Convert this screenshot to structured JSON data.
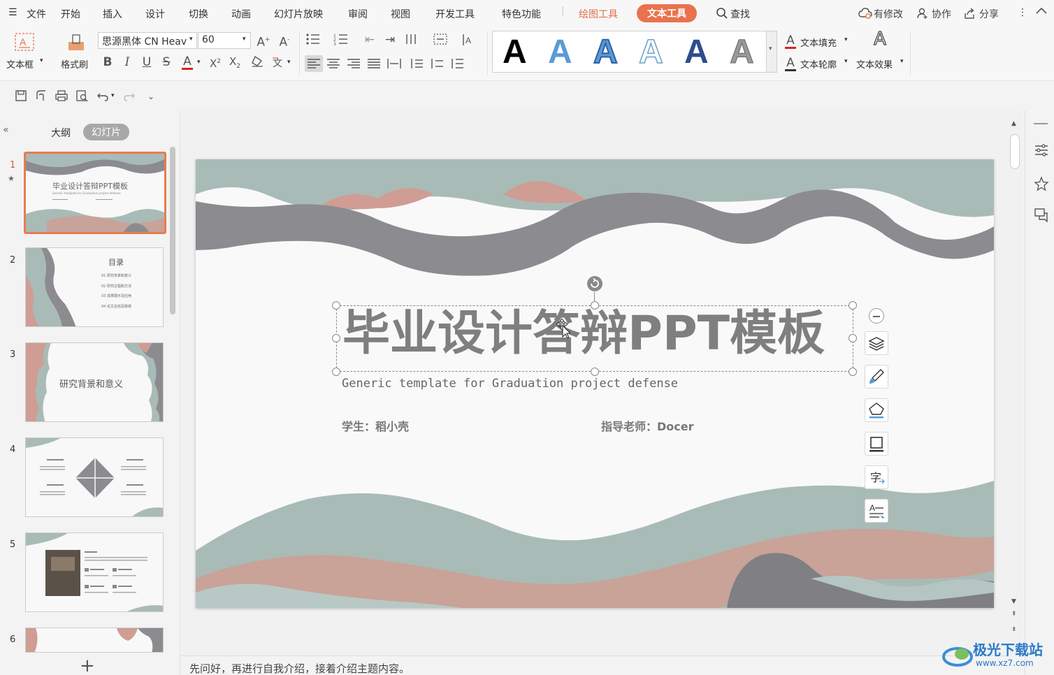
{
  "menu": {
    "file": "文件",
    "tabs": [
      "开始",
      "插入",
      "设计",
      "切换",
      "动画",
      "幻灯片放映",
      "审阅",
      "视图",
      "开发工具",
      "特色功能"
    ],
    "context_tab_draw": "绘图工具",
    "context_tab_text": "文本工具",
    "search": "查找",
    "right": {
      "changes": "有修改",
      "collab": "协作",
      "share": "分享"
    }
  },
  "ribbon": {
    "textbox_label": "文本框",
    "format_painter_label": "格式刷",
    "font_name": "思源黑体 CN Heav",
    "font_size": "60",
    "text_fill_label": "文本填充",
    "text_outline_label": "文本轮廓",
    "text_effect_label": "文本效果",
    "style_glyph": "A"
  },
  "panel": {
    "tab_outline": "大纲",
    "tab_slides": "幻灯片",
    "numbers": [
      "1",
      "2",
      "3",
      "4",
      "5",
      "6"
    ],
    "add_symbol": "+"
  },
  "thumbs": {
    "t1_title": "毕业设计答辩PPT模板",
    "t1_sub": "Generic template for Graduation project defense",
    "t2_title": "目录",
    "t2_items": [
      "01  研究背景和意义",
      "02  研究过程和方法",
      "03  成果展示及应用",
      "04  论文总结及致谢"
    ],
    "t3_title": "研究背景和意义"
  },
  "slide": {
    "title": "毕业设计答辩PPT模板",
    "subtitle": "Generic template for Graduation project defense",
    "student": "学生：稻小壳",
    "advisor": "指导老师：Docer"
  },
  "notes": "先问好，再进行自我介绍，接着介绍主题内容。",
  "watermark": {
    "name": "极光下载站",
    "url": "www.xz7.com"
  },
  "colors": {
    "accent": "#e8734e",
    "wave_gray": "#8b8b90",
    "wave_teal": "#a9bbb6",
    "wave_pink": "#cf9d93"
  }
}
